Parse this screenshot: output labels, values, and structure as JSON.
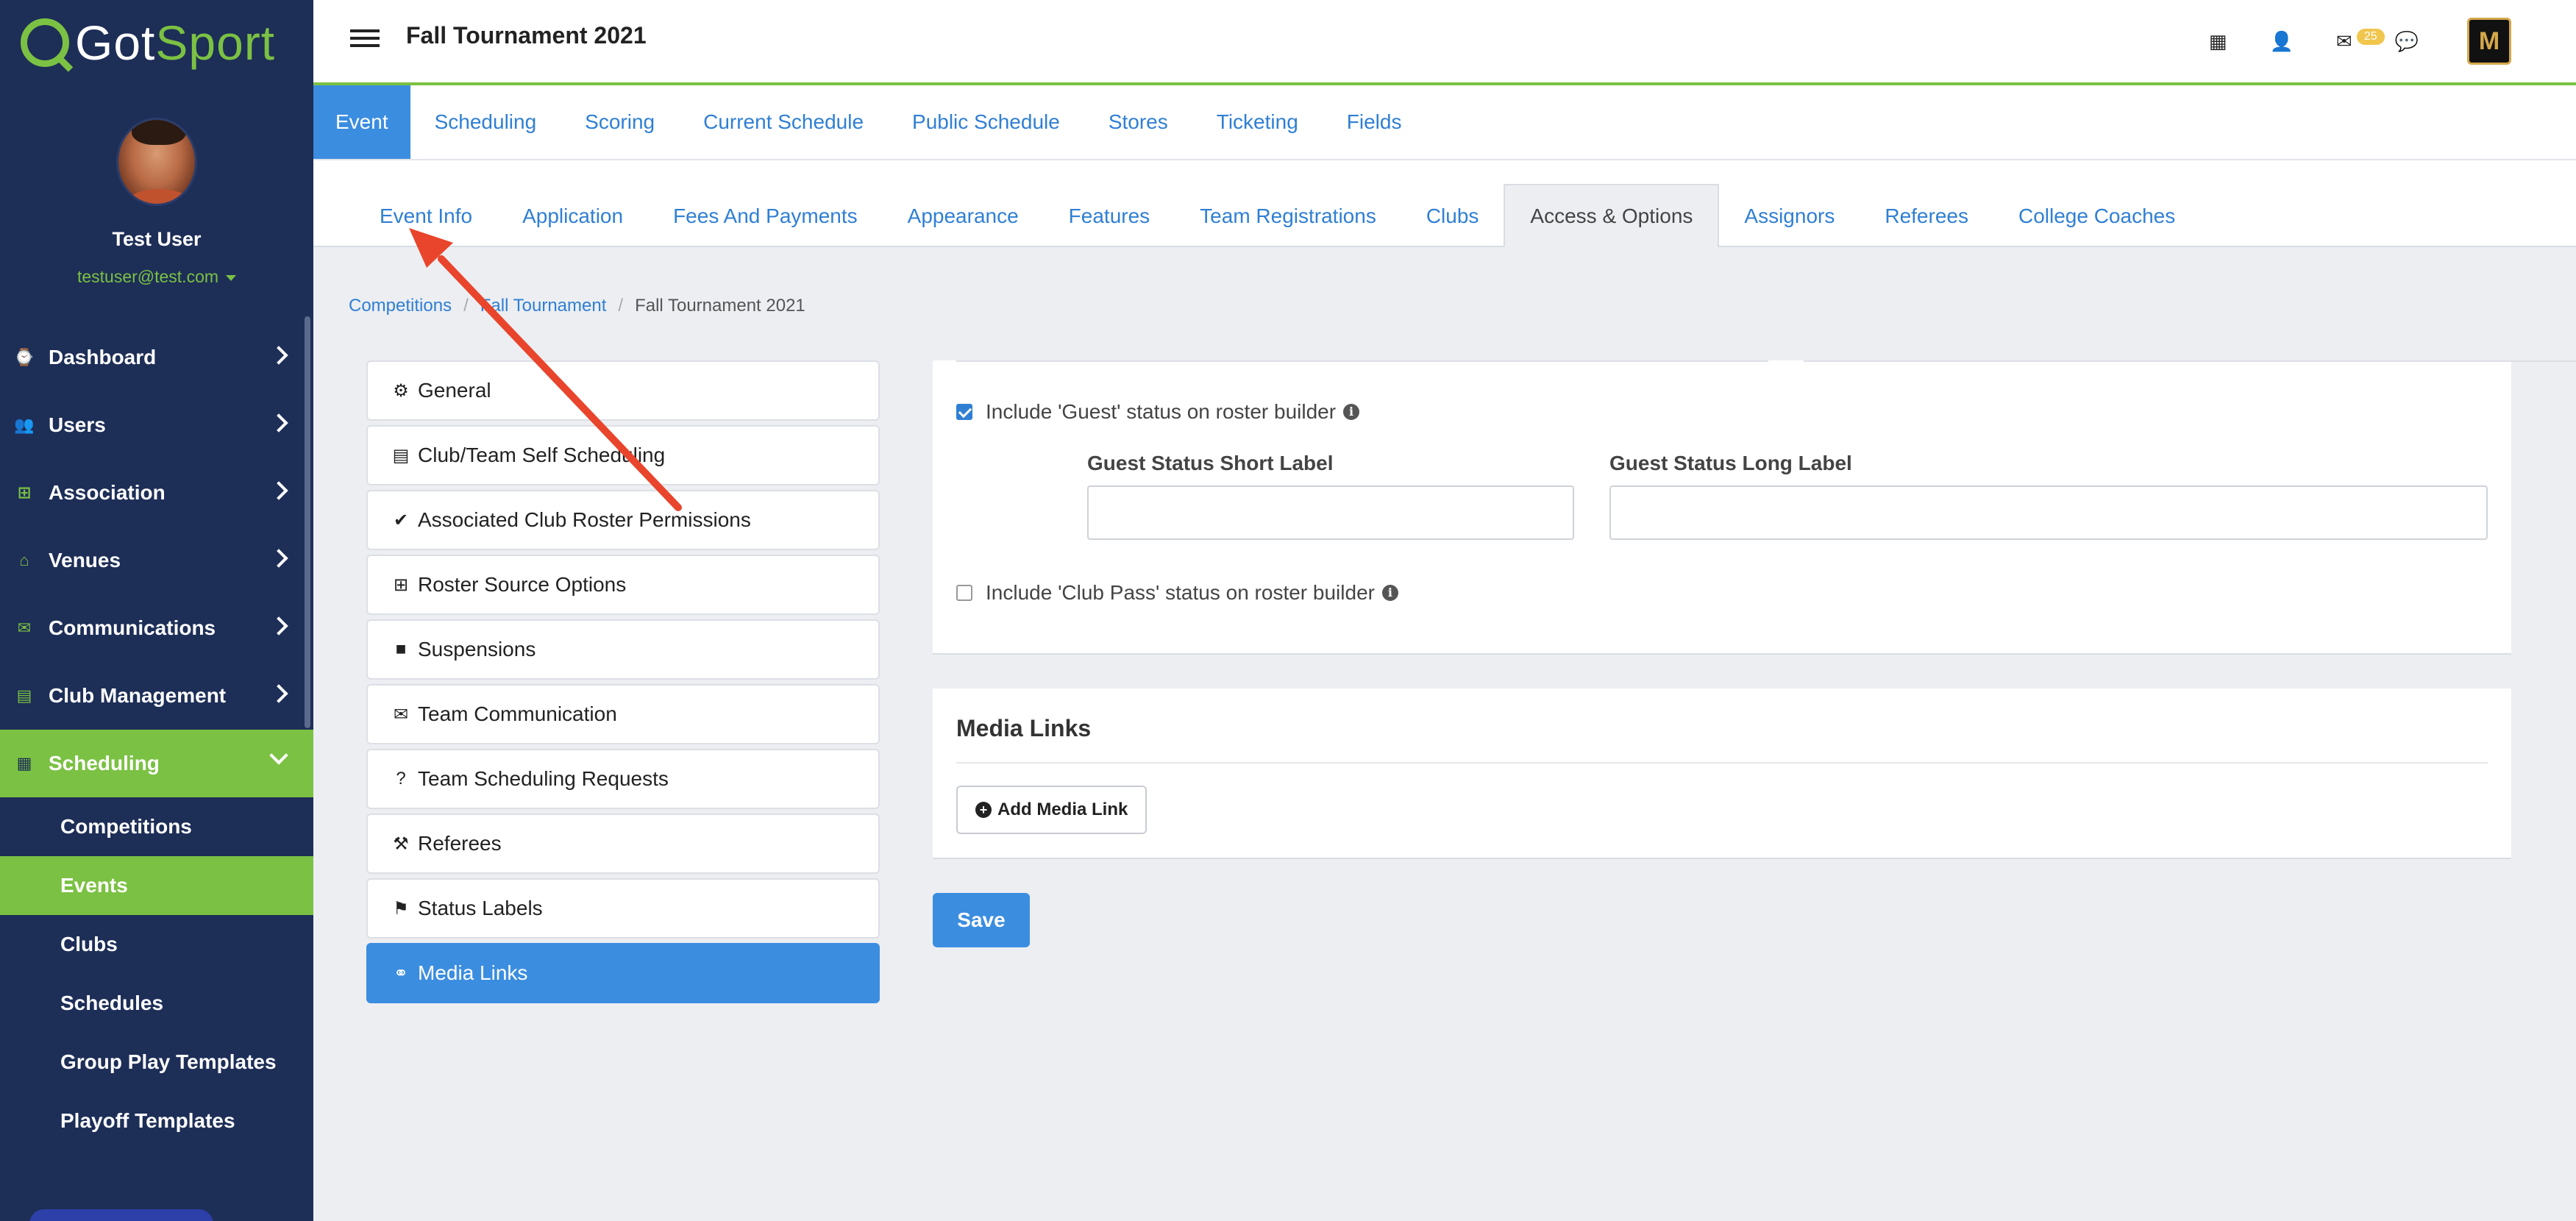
{
  "logo": {
    "part1": "Got",
    "part2": "Sport"
  },
  "profile": {
    "name": "Test User",
    "email": "testuser@test.com"
  },
  "nav": {
    "items": [
      {
        "label": "Dashboard",
        "icon": "⌚"
      },
      {
        "label": "Users",
        "icon": "👥"
      },
      {
        "label": "Association",
        "icon": "⊞"
      },
      {
        "label": "Venues",
        "icon": "⌂"
      },
      {
        "label": "Communications",
        "icon": "✉"
      },
      {
        "label": "Club Management",
        "icon": "▤"
      }
    ],
    "active": {
      "label": "Scheduling",
      "icon": "▦"
    },
    "sub_items": [
      "Competitions",
      "Events",
      "Clubs",
      "Schedules",
      "Group Play Templates",
      "Playoff Templates"
    ]
  },
  "header": {
    "title": "Fall Tournament 2021",
    "message_count": "25",
    "avatar_letter": "M"
  },
  "primary_tabs": [
    "Event",
    "Scheduling",
    "Scoring",
    "Current Schedule",
    "Public Schedule",
    "Stores",
    "Ticketing",
    "Fields"
  ],
  "secondary_tabs": [
    "Event Info",
    "Application",
    "Fees And Payments",
    "Appearance",
    "Features",
    "Team Registrations",
    "Clubs",
    "Access & Options",
    "Assignors",
    "Referees",
    "College Coaches"
  ],
  "breadcrumb": {
    "items": [
      "Competitions",
      "Fall Tournament"
    ],
    "current": "Fall Tournament 2021"
  },
  "settings_menu": [
    {
      "label": "General",
      "icon": "⚙"
    },
    {
      "label": "Club/Team Self Scheduling",
      "icon": "▤"
    },
    {
      "label": "Associated Club Roster Permissions",
      "icon": "✔"
    },
    {
      "label": "Roster Source Options",
      "icon": "⊞"
    },
    {
      "label": "Suspensions",
      "icon": "■"
    },
    {
      "label": "Team Communication",
      "icon": "✉"
    },
    {
      "label": "Team Scheduling Requests",
      "icon": "?"
    },
    {
      "label": "Referees",
      "icon": "⚒"
    },
    {
      "label": "Status Labels",
      "icon": "⚑"
    },
    {
      "label": "Media Links",
      "icon": "⚭"
    }
  ],
  "roster": {
    "guest_check_label": "Include 'Guest' status on roster builder",
    "guest_short_label": "Guest Status Short Label",
    "guest_long_label": "Guest Status Long Label",
    "guest_short_value": "",
    "guest_long_value": "",
    "clubpass_check_label": "Include 'Club Pass' status on roster builder"
  },
  "media": {
    "title": "Media Links",
    "add_button": "Add Media Link"
  },
  "save_label": "Save",
  "colors": {
    "brand_green": "#7bc143",
    "sidebar_navy": "#1d2e57",
    "link_blue": "#2f7fd4",
    "active_blue": "#3b8de0",
    "arrow_red": "#e8452c"
  }
}
